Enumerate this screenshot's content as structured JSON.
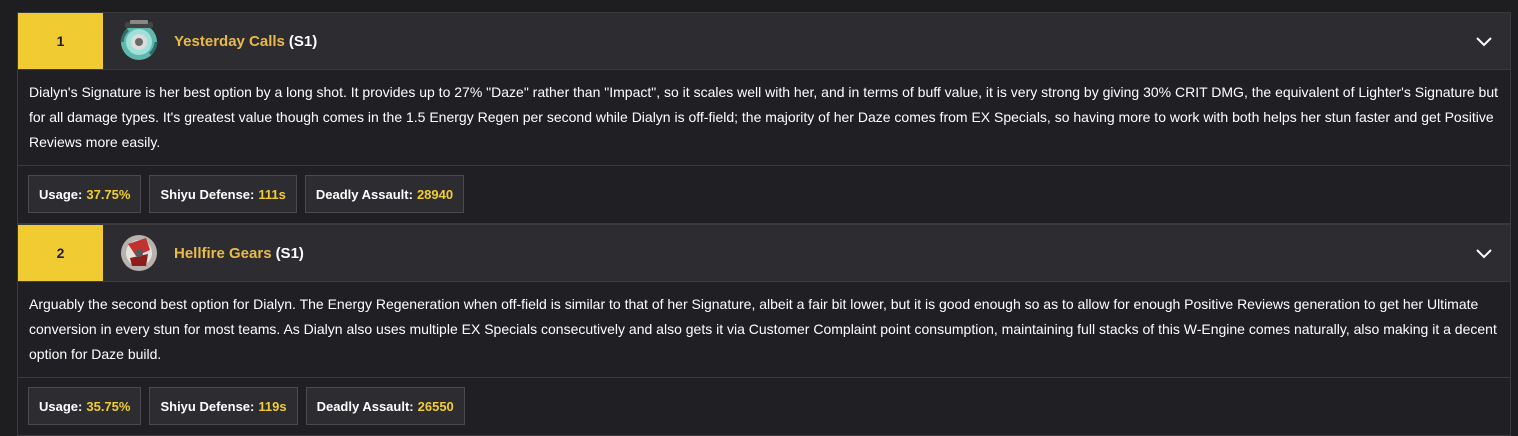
{
  "entries": [
    {
      "rank": "1",
      "name": "Yesterday Calls",
      "rarity": "(S1)",
      "icon": "yesterday-calls-engine-icon",
      "description": "Dialyn's Signature is her best option by a long shot. It provides up to 27% \"Daze\" rather than \"Impact\", so it scales well with her, and in terms of buff value, it is very strong by giving 30% CRIT DMG, the equivalent of Lighter's Signature but for all damage types. It's greatest value though comes in the 1.5 Energy Regen per second while Dialyn is off-field; the majority of her Daze comes from EX Specials, so having more to work with both helps her stun faster and get Positive Reviews more easily.",
      "stats": [
        {
          "label": "Usage:",
          "value": "37.75%"
        },
        {
          "label": "Shiyu Defense:",
          "value": "111s"
        },
        {
          "label": "Deadly Assault:",
          "value": "28940"
        }
      ]
    },
    {
      "rank": "2",
      "name": "Hellfire Gears",
      "rarity": "(S1)",
      "icon": "hellfire-gears-engine-icon",
      "description": "Arguably the second best option for Dialyn. The Energy Regeneration when off-field is similar to that of her Signature, albeit a fair bit lower, but it is good enough so as to allow for enough Positive Reviews generation to get her Ultimate conversion in every stun for most teams. As Dialyn also uses multiple EX Specials consecutively and also gets it via Customer Complaint point consumption, maintaining full stacks of this W-Engine comes naturally, also making it a decent option for Daze build.",
      "stats": [
        {
          "label": "Usage:",
          "value": "35.75%"
        },
        {
          "label": "Shiyu Defense:",
          "value": "119s"
        },
        {
          "label": "Deadly Assault:",
          "value": "26550"
        }
      ]
    }
  ],
  "colors": {
    "accent": "#f0cc32",
    "name": "#e9b94a",
    "background": "#1e1e20"
  }
}
